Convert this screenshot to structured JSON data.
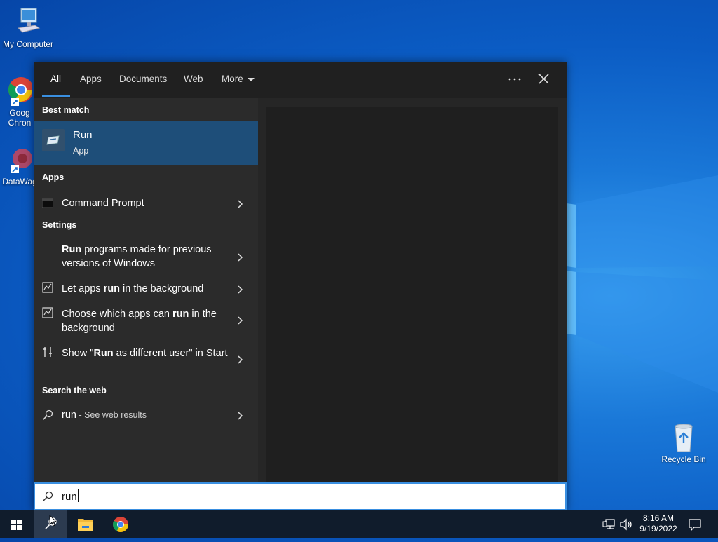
{
  "desktop": {
    "icons": [
      {
        "label": "My Computer"
      },
      {
        "label": "Goog Chron"
      },
      {
        "label": "DataWag"
      },
      {
        "label": "Recycle Bin"
      }
    ]
  },
  "search": {
    "tabs": [
      {
        "label": "All"
      },
      {
        "label": "Apps"
      },
      {
        "label": "Documents"
      },
      {
        "label": "Web"
      },
      {
        "label": "More"
      }
    ],
    "sections": {
      "best_match": "Best match",
      "apps": "Apps",
      "settings": "Settings",
      "search_web": "Search the web"
    },
    "best_match": {
      "title": "Run",
      "subtitle": "App"
    },
    "apps": [
      {
        "label": "Command Prompt"
      }
    ],
    "settings": [
      {
        "bold": "Run",
        "rest": " programs made for previous versions of Windows"
      },
      {
        "pre": "Let apps ",
        "bold": "run",
        "rest": " in the background"
      },
      {
        "pre": "Choose which apps can ",
        "bold": "run",
        "rest": " in the background"
      },
      {
        "pre": "Show \"",
        "bold": "Run",
        "rest": " as different user\" in Start"
      }
    ],
    "web": {
      "query": "run",
      "suffix": " - See web results"
    },
    "input_value": "run"
  },
  "taskbar": {
    "time": "8:16 AM",
    "date": "9/19/2022"
  },
  "colors": {
    "accent": "#3a8fe0",
    "selected": "#1e4e79",
    "flyout_bg": "#2b2b2b"
  }
}
